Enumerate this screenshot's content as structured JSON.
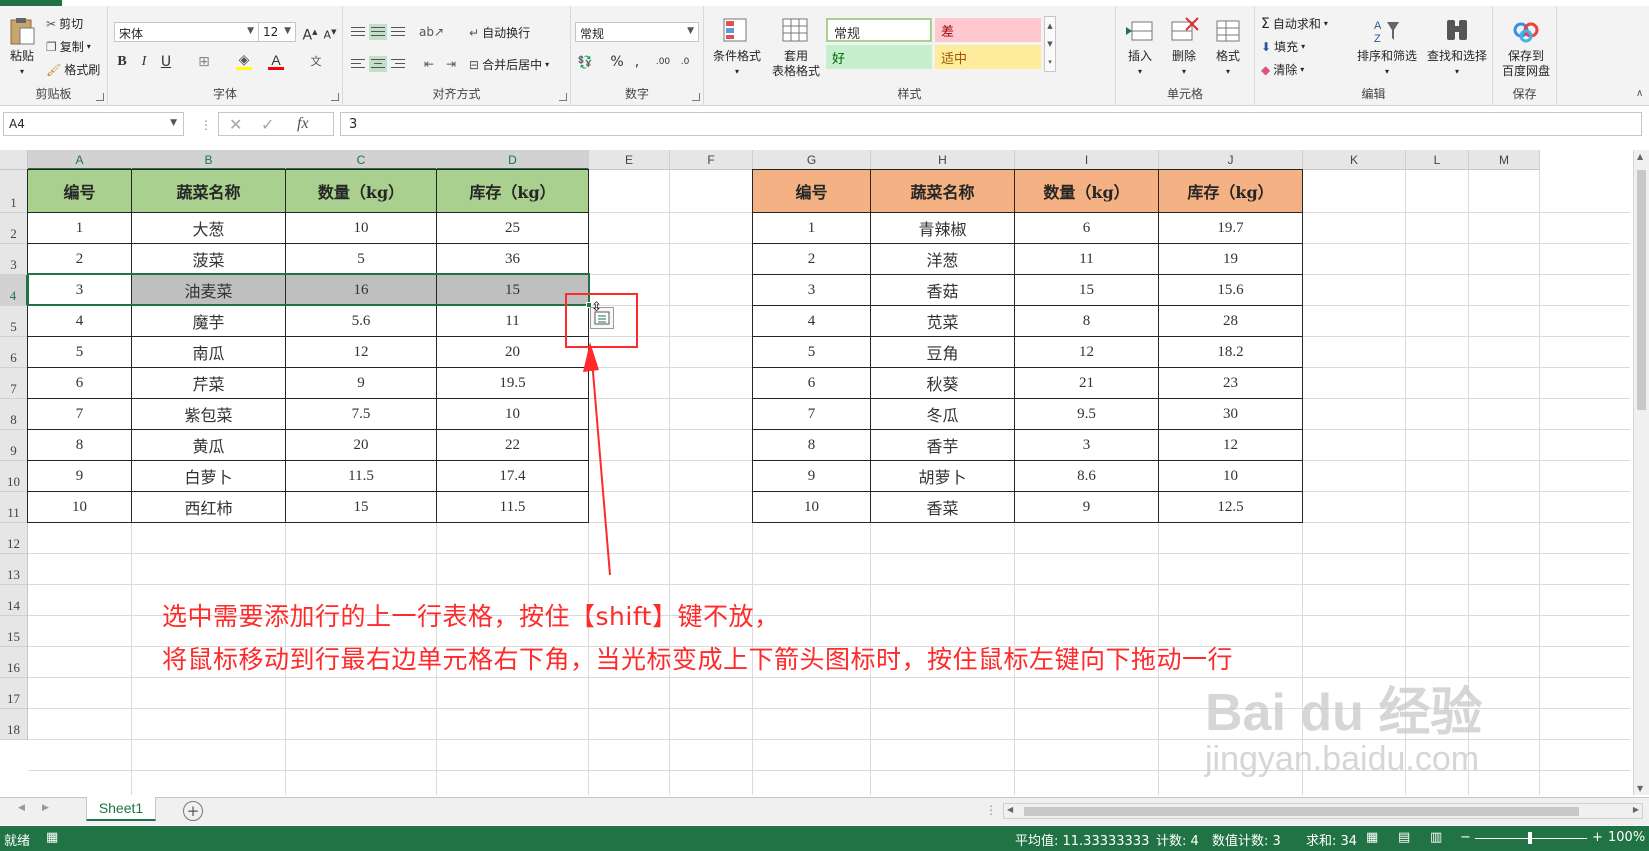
{
  "ribbon": {
    "clipboard": {
      "paste": "粘贴",
      "cut": "剪切",
      "copy": "复制",
      "format_painter": "格式刷",
      "group": "剪贴板"
    },
    "font": {
      "name": "宋体",
      "size": "12",
      "group": "字体"
    },
    "alignment": {
      "wrap": "自动换行",
      "merge": "合并后居中",
      "group": "对齐方式"
    },
    "number": {
      "format": "常规",
      "group": "数字"
    },
    "styles": {
      "conditional": "条件格式",
      "table_line1": "套用",
      "table_line2": "表格格式",
      "normal": "常规",
      "bad": "差",
      "good": "好",
      "neutral": "适中",
      "group": "样式"
    },
    "cells": {
      "insert": "插入",
      "delete": "删除",
      "format": "格式",
      "group": "单元格"
    },
    "editing": {
      "autosum": "自动求和",
      "fill": "填充",
      "clear": "清除",
      "sort": "排序和筛选",
      "find": "查找和选择",
      "group": "编辑"
    },
    "save": {
      "line1": "保存到",
      "line2": "百度网盘",
      "group": "保存"
    },
    "colors": {
      "accent": "#217346",
      "good_bg": "#c6efce",
      "good_fg": "#006100",
      "bad_bg": "#ffc7ce",
      "bad_fg": "#9c0006",
      "neutral_bg": "#ffeb9c",
      "neutral_fg": "#9c5700"
    }
  },
  "formula_bar": {
    "name_box": "A4",
    "fx": "fx",
    "value": "3"
  },
  "columns": [
    "A",
    "B",
    "C",
    "D",
    "E",
    "F",
    "G",
    "H",
    "I",
    "J",
    "K",
    "L",
    "M"
  ],
  "rows": [
    "1",
    "2",
    "3",
    "4",
    "5",
    "6",
    "7",
    "8",
    "9",
    "10",
    "11",
    "12",
    "13",
    "14",
    "15",
    "16",
    "17",
    "18"
  ],
  "left_table": {
    "headers": [
      "编号",
      "蔬菜名称",
      "数量（kg）",
      "库存（kg）"
    ],
    "rows": [
      [
        "1",
        "大葱",
        "10",
        "25"
      ],
      [
        "2",
        "菠菜",
        "5",
        "36"
      ],
      [
        "3",
        "油麦菜",
        "16",
        "15"
      ],
      [
        "4",
        "魔芋",
        "5.6",
        "11"
      ],
      [
        "5",
        "南瓜",
        "12",
        "20"
      ],
      [
        "6",
        "芹菜",
        "9",
        "19.5"
      ],
      [
        "7",
        "紫包菜",
        "7.5",
        "10"
      ],
      [
        "8",
        "黄瓜",
        "20",
        "22"
      ],
      [
        "9",
        "白萝卜",
        "11.5",
        "17.4"
      ],
      [
        "10",
        "西红柿",
        "15",
        "11.5"
      ]
    ],
    "header_color": "#a9d08e"
  },
  "right_table": {
    "headers": [
      "编号",
      "蔬菜名称",
      "数量（kg）",
      "库存（kg）"
    ],
    "rows": [
      [
        "1",
        "青辣椒",
        "6",
        "19.7"
      ],
      [
        "2",
        "洋葱",
        "11",
        "19"
      ],
      [
        "3",
        "香菇",
        "15",
        "15.6"
      ],
      [
        "4",
        "苋菜",
        "8",
        "28"
      ],
      [
        "5",
        "豆角",
        "12",
        "18.2"
      ],
      [
        "6",
        "秋葵",
        "21",
        "23"
      ],
      [
        "7",
        "冬瓜",
        "9.5",
        "30"
      ],
      [
        "8",
        "香芋",
        "3",
        "12"
      ],
      [
        "9",
        "胡萝卜",
        "8.6",
        "10"
      ],
      [
        "10",
        "香菜",
        "9",
        "12.5"
      ]
    ],
    "header_color": "#f4b183"
  },
  "annotation": {
    "line1": "选中需要添加行的上一行表格，按住【shift】键不放，",
    "line2": "将鼠标移动到行最右边单元格右下角，当光标变成上下箭头图标时，按住鼠标左键向下拖动一行",
    "color": "#ff2a2a"
  },
  "watermark": {
    "logo": "Bai du 经验",
    "url": "jingyan.baidu.com"
  },
  "sheet_tabs": {
    "active": "Sheet1"
  },
  "status_bar": {
    "ready": "就绪",
    "average": "平均值: 11.33333333",
    "count": "计数: 4",
    "numeric_count": "数值计数: 3",
    "sum": "求和: 34",
    "zoom": "100%"
  }
}
